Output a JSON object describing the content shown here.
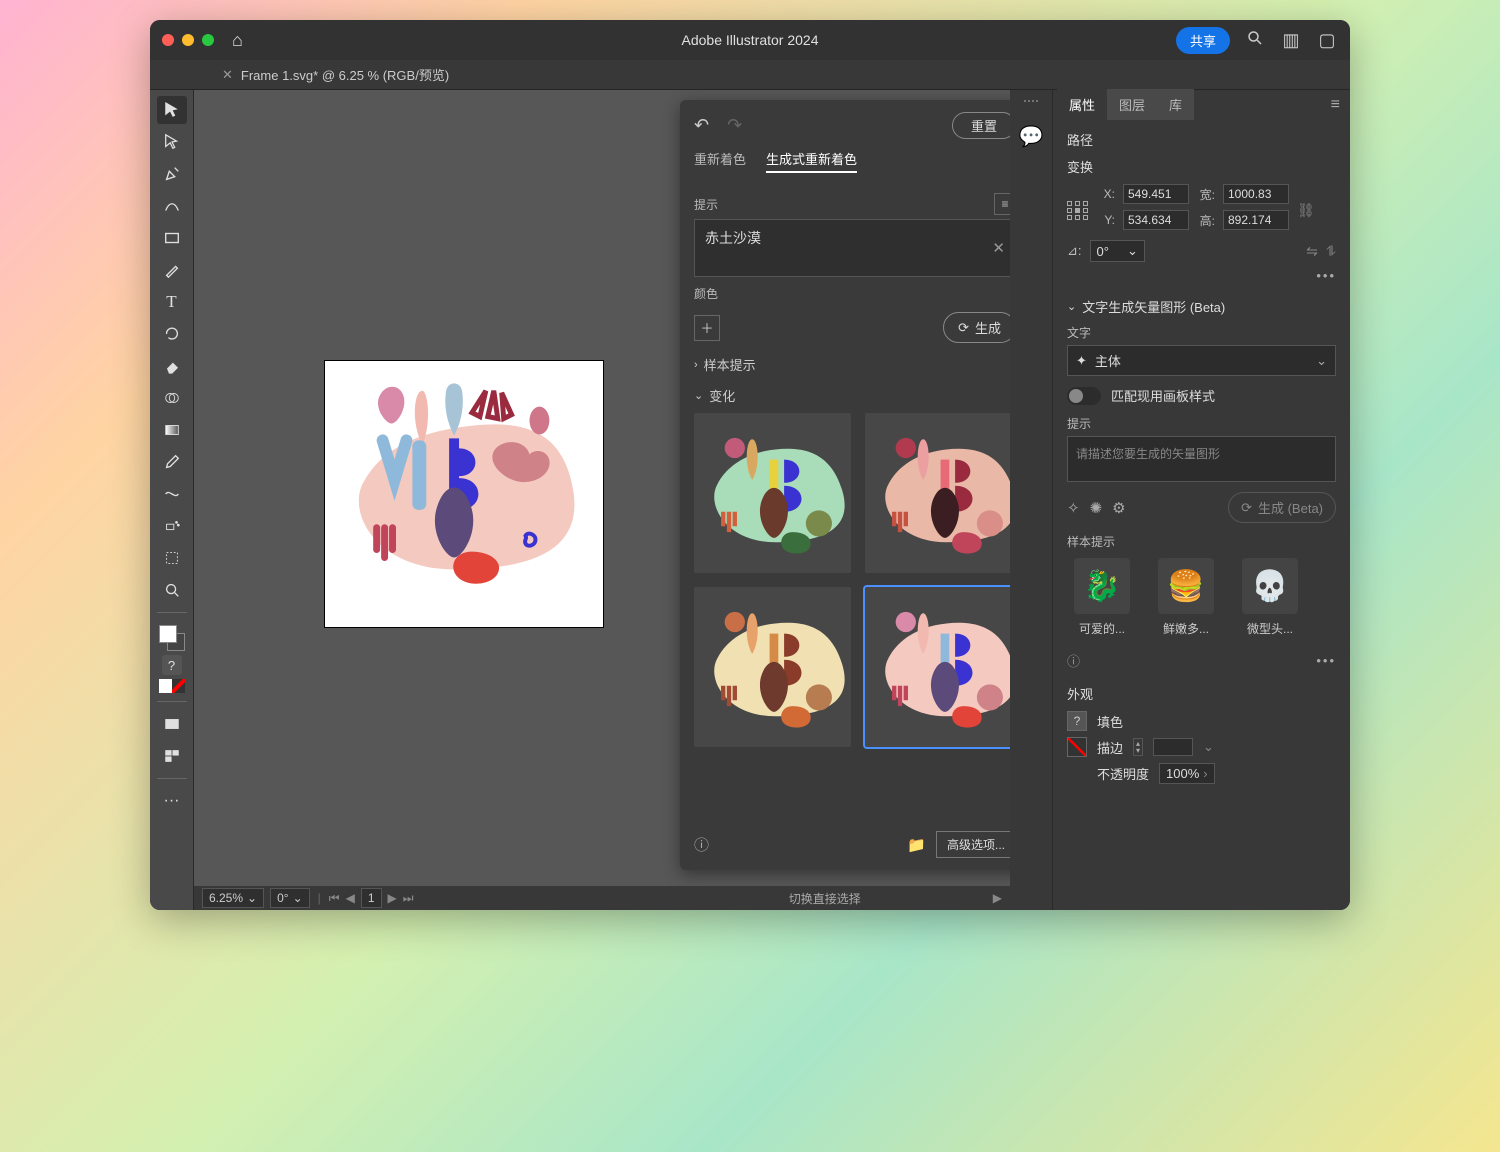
{
  "titlebar": {
    "app_title": "Adobe Illustrator 2024",
    "share": "共享"
  },
  "doc_tab": {
    "name": "Frame 1.svg* @ 6.25 % (RGB/预览)"
  },
  "status": {
    "zoom": "6.25%",
    "rotate": "0°",
    "artboard": "1",
    "hint": "切换直接选择"
  },
  "recolor": {
    "reset": "重置",
    "tab_recolor": "重新着色",
    "tab_gen": "生成式重新着色",
    "prompt_label": "提示",
    "prompt_value": "赤土沙漠",
    "color_label": "颜色",
    "generate": "生成",
    "samples": "样本提示",
    "variations": "变化",
    "advanced": "高级选项..."
  },
  "panels": {
    "tab_props": "属性",
    "tab_layers": "图层",
    "tab_libs": "库",
    "path": "路径",
    "transform": "变换",
    "x_lab": "X:",
    "x": "549.451",
    "y_lab": "Y:",
    "y": "534.634",
    "w_lab": "宽:",
    "w": "1000.83",
    "h_lab": "高:",
    "h": "892.174",
    "angle": "0°",
    "gen_section": "文字生成矢量图形 (Beta)",
    "text_lab": "文字",
    "subject": "主体",
    "match_artboard": "匹配现用画板样式",
    "prompt_lab": "提示",
    "prompt_ph": "请描述您要生成的矢量图形",
    "gen_btn": "生成 (Beta)",
    "samples_lab": "样本提示",
    "sample1": "可爱的...",
    "sample2": "鲜嫩多...",
    "sample3": "微型头...",
    "appearance": "外观",
    "fill": "填色",
    "stroke": "描边",
    "opacity": "不透明度",
    "opacity_val": "100%"
  }
}
